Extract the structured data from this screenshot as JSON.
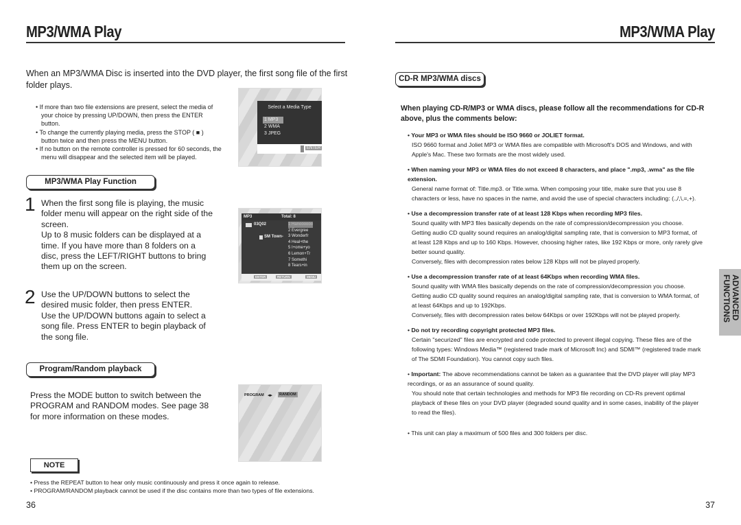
{
  "left": {
    "title": "MP3/WMA Play",
    "intro": "When an MP3/WMA Disc is inserted into the DVD player, the first song file of the first folder plays.",
    "bullets": [
      "If more than two file extensions are present, select the media of your choice by pressing UP/DOWN, then press the ENTER button.",
      "To change the currently playing media, press the STOP ( ■ ) button twice and then press the MENU button.",
      "If no button on the remote controller is pressed for 60 seconds, the menu will disappear and the selected item will be played."
    ],
    "screen1": {
      "title": "Select a Media Type",
      "options": [
        "1  MP3",
        "2  WMA",
        "3  JPEG"
      ],
      "enter": "ENTER"
    },
    "section1": "MP3/WMA Play Function",
    "step1_num": "1",
    "step1": "When the first song file is playing, the music folder menu will appear on the right side of the screen.\nUp to 8 music folders can be displayed at a time. If you have more than 8 folders on a disc, press the LEFT/RIGHT buttons to bring them up on the screen.",
    "step2_num": "2",
    "step2": "Use the UP/DOWN buttons to select the desired music folder, then press ENTER.\nUse the UP/DOWN buttons again to select a song file. Press ENTER to begin playback of the song file.",
    "screen2": {
      "label": "MP3",
      "total": "Total: 8",
      "folder": "03Q02",
      "subfolder": "SM Town-",
      "files": [
        "1 Hanoooooo",
        "2 Evergree",
        "3 Wonderfr",
        "4 Heal+the",
        "5 I+ome+yo",
        "6 Lemon+Tr",
        "7 Somethi",
        "8 Tears+in"
      ],
      "buttons": [
        "ENTER",
        "RETURN",
        "MENU"
      ]
    },
    "section2": "Program/Random playback",
    "program_text": "Press the MODE button to switch between the PROGRAM and RANDOM modes. See page 38 for more information on these modes.",
    "screen3": {
      "program": "PROGRAM",
      "random": "RANDOM"
    },
    "note_label": "NOTE",
    "notes": [
      "Press the REPEAT button to hear only music continuously and press it once again to release.",
      "PROGRAM/RANDOM playback cannot be used if the disc contains more than two types of file extensions."
    ],
    "page": "36"
  },
  "right": {
    "title": "MP3/WMA Play",
    "section": "CD-R MP3/WMA discs",
    "lead": "When playing CD-R/MP3 or WMA discs, please follow all the recommendations for CD-R above, plus the comments below:",
    "items": [
      {
        "head": "Your MP3 or WMA files should be ISO 9660 or JOLIET format.",
        "body": [
          "ISO 9660 format and Joliet MP3 or WMA files are compatible with Microsoft's DOS and Windows, and with Apple's Mac. These two formats are the most widely used."
        ]
      },
      {
        "head": "When naming your MP3 or WMA files do not exceed 8 characters, and place \".mp3, .wma\" as the file extension.",
        "body": [
          "General name format of: Title.mp3. or Title.wma. When composing your title, make sure that you use 8 characters or less, have no spaces in the name, and avoid the use of special characters including: (.,/,\\,=,+)."
        ]
      },
      {
        "head": "Use a decompression transfer rate of at least 128 Kbps when recording MP3 files.",
        "body": [
          "Sound quality with MP3 files basically depends on the rate of compression/decompression you choose. Getting audio CD quality sound requires an analog/digital sampling rate, that is conversion to MP3 format, of at least 128 Kbps and up to 160 Kbps. However, choosing higher rates, like 192 Kbps or more, only rarely give better sound quality.",
          "Conversely, files with decompression rates below 128 Kbps will not be played properly."
        ]
      },
      {
        "head": "Use a decompression transfer rate of at least 64Kbps when recording WMA files.",
        "body": [
          "Sound quality with WMA files basically depends on the rate of compression/decompression you choose. Getting audio CD quality sound requires an analog/digital sampling rate, that is conversion to WMA format, of at least 64Kbps and up to 192Kbps.",
          "Conversely, files with decompression rates  below 64Kbps or over 192Kbps will not be played properly."
        ]
      },
      {
        "head": "Do not try recording copyright protected MP3 files.",
        "body": [
          "Certain \"securized\" files are encrypted and code protected to prevent illegal copying. These files are of the following types: Windows Media™ (registered trade mark of Microsoft Inc) and SDMI™ (registered trade mark of The SDMI Foundation). You cannot copy such files."
        ]
      }
    ],
    "important_label": "Important:",
    "important": "The above recommendations cannot be taken as a guarantee that the DVD player will play MP3 recordings, or as an assurance of sound quality.",
    "important2": "You should note that certain technologies and methods for MP3 file recording on CD-Rs prevent optimal playback of these files on your DVD player (degraded sound quality and in some cases, inability of the player to read the files).",
    "max": "This unit can play a maximum of 500 files and 300 folders per disc.",
    "tab": [
      "ADVANCED",
      "FUNCTIONS"
    ],
    "page": "37"
  }
}
